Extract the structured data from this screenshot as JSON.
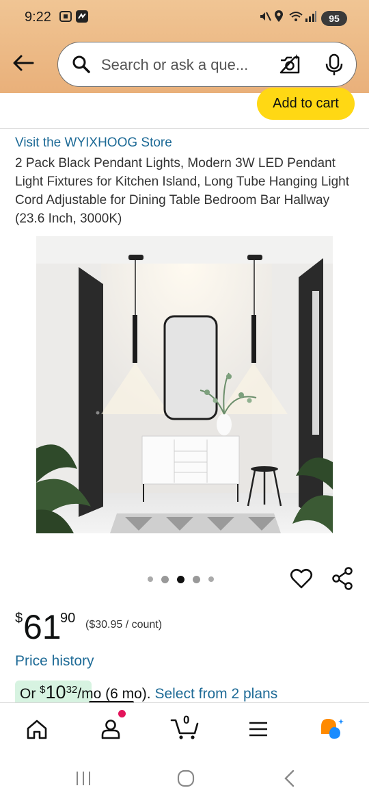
{
  "status_bar": {
    "time": "9:22",
    "battery": "95"
  },
  "search": {
    "placeholder": "Search or ask a que..."
  },
  "cart_bar": {
    "add_to_cart_label": "Add to cart"
  },
  "product": {
    "store_link": "Visit the WYIXHOOG Store",
    "title": "2 Pack Black Pendant Lights, Modern 3W LED Pendant Light Fixtures for Kitchen Island, Long Tube Hanging Light Cord Adjustable for Dining Table Bedroom Bar Hallway (23.6 Inch, 3000K)",
    "image_icon": "product-photo",
    "carousel_dot_count": 5,
    "carousel_active_index": 2
  },
  "price": {
    "symbol": "$",
    "whole": "61",
    "fraction": "90",
    "unit_price": "($30.95 / count)",
    "price_history_label": "Price history"
  },
  "monthly": {
    "prefix": "Or ",
    "symbol": "$",
    "whole": "10",
    "fraction": "32",
    "suffix": "/mo (6 mo). ",
    "plans_link": "Select from 2 plans"
  },
  "bottom_nav": {
    "items": [
      "home-icon",
      "account-icon",
      "cart-icon",
      "menu-icon",
      "rufus-icon"
    ],
    "cart_count": "0"
  },
  "colors": {
    "header_gradient_top": "#f0c594",
    "add_to_cart": "#ffd814",
    "link": "#1d6a96",
    "monthly_highlight": "#d7f3e1",
    "badge": "#e3145b",
    "rufus_orange": "#ff8a00",
    "rufus_blue": "#1a8cff"
  }
}
